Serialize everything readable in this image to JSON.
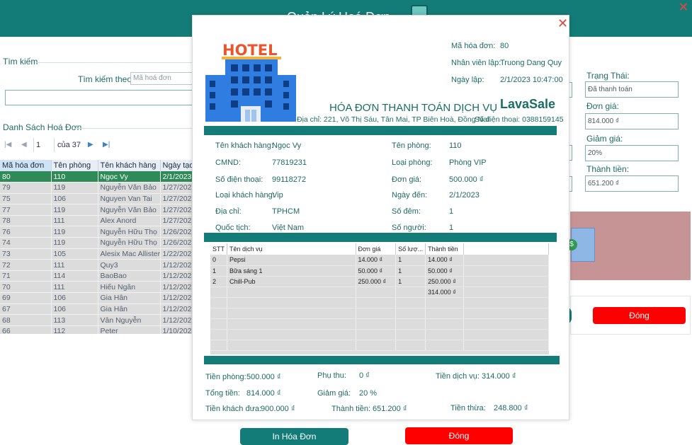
{
  "background_window": {
    "title": "Quản Lý Hoá Đơn",
    "search": {
      "legend": "Tìm kiếm",
      "search_by_label": "Tìm kiếm theo:",
      "search_by_value": "Mã hoá đơn",
      "input_value": ""
    },
    "list": {
      "legend": "Danh Sách Hoá Đơn",
      "pager": {
        "current_page": "1",
        "of_text": "của 37"
      },
      "columns": [
        "Mã hóa đơn",
        "Tên phòng",
        "Tên khách hàng",
        "Ngày tạo"
      ],
      "rows": [
        [
          "80",
          "110",
          "Ngọc Vy",
          "2/1/2023"
        ],
        [
          "79",
          "119",
          "Nguyễn Văn Bảo",
          "1/27/2023"
        ],
        [
          "75",
          "106",
          "Nguyen Van Tai",
          "1/27/2023"
        ],
        [
          "77",
          "119",
          "Nguyễn Văn Bảo",
          "1/27/2023"
        ],
        [
          "78",
          "111",
          "Alex Anord",
          "1/27/2023"
        ],
        [
          "76",
          "119",
          "Nguyễn Hữu Thọ",
          "1/26/2023"
        ],
        [
          "74",
          "119",
          "Nguyễn Hữu Thọ",
          "1/26/2023"
        ],
        [
          "73",
          "105",
          "Alesix Mac Allister",
          "1/22/2023"
        ],
        [
          "72",
          "111",
          "Quy3",
          "1/12/2023"
        ],
        [
          "71",
          "114",
          "BaoBao",
          "1/12/2023"
        ],
        [
          "70",
          "111",
          "Hiếu Ngân",
          "1/12/2023"
        ],
        [
          "69",
          "106",
          "Gia Hân",
          "1/12/2023"
        ],
        [
          "67",
          "106",
          "Gia Hân",
          "1/12/2023"
        ],
        [
          "68",
          "113",
          "Vân Nguyễn",
          "1/12/2023"
        ],
        [
          "66",
          "112",
          "Peter",
          "1/10/2023"
        ]
      ]
    },
    "right_panel": {
      "status_label": "Trạng Thái:",
      "status_value": "Đã thanh toán",
      "price_label": "Đơn giá:",
      "price_value": "814.000 ₫",
      "discount_label": "Giảm giá:",
      "discount_value": "20%",
      "total_label": "Thành tiền:",
      "total_value": "651.200 ₫",
      "close_button": "Đóng"
    }
  },
  "invoice_dialog": {
    "close_icon": "close-icon",
    "logo_text": "HOTEL",
    "header": {
      "invoice_id_label": "Mã hóa đơn:",
      "invoice_id": "80",
      "staff_label": "Nhân viên lập:",
      "staff": "Truong Dang Quy",
      "date_label": "Ngày lập:",
      "date": "2/1/2023 10:47:00"
    },
    "title": "HÓA ĐƠN THANH TOÁN DỊCH VỤ",
    "brand": "LavaSale",
    "address": "Địa chỉ: 221, Võ Thị Sáu, Tân Mai, TP Biên Hoà, Đồng Nai",
    "phone": "Số điện thoại: 0388159145",
    "customer": {
      "name_label": "Tên khách hàng:",
      "name": "Ngọc Vy",
      "id_label": "CMND:",
      "id": "77819231",
      "phone_label": "Số điện thoại:",
      "phone": "99118272",
      "type_label": "Loại khách hàng:",
      "type": "Vip",
      "address_label": "Địa chỉ:",
      "address": "TPHCM",
      "nationality_label": "Quốc tịch:",
      "nationality": "Việt Nam"
    },
    "room": {
      "name_label": "Tên phòng:",
      "name": "110",
      "type_label": "Loại phòng:",
      "type": "Phòng VIP",
      "price_label": "Đơn giá:",
      "price": "500.000 ₫",
      "arrival_label": "Ngày đến:",
      "arrival": "2/1/2023",
      "nights_label": "Số đêm:",
      "nights": "1",
      "people_label": "Số người:",
      "people": "1"
    },
    "services": {
      "columns": [
        "STT",
        "Tên dịch vụ",
        "Đơn giá",
        "Số lượ...",
        "Thành tiền"
      ],
      "rows": [
        [
          "0",
          "Pepsi",
          "14.000 ₫",
          "1",
          "14.000 ₫"
        ],
        [
          "1",
          "Bữa sáng 1",
          "50.000 ₫",
          "1",
          "50.000 ₫"
        ],
        [
          "2",
          "Chill-Pub",
          "250.000 ₫",
          "1",
          "250.000 ₫"
        ],
        [
          "",
          "",
          "",
          "",
          "314.000 ₫"
        ]
      ]
    },
    "summary": {
      "room_fee_label": "Tiền phòng:",
      "room_fee": "500.000 ₫",
      "surcharge_label": "Phụ thu:",
      "surcharge": "0 ₫",
      "service_fee_label": "Tiền dịch vụ:",
      "service_fee": "314.000 ₫",
      "total_label": "Tổng tiền:",
      "total": "814.000 ₫",
      "discount_label": "Giảm giá:",
      "discount": "20 %",
      "paid_label": "Tiền khách đưa:",
      "paid": "900.000 ₫",
      "final_label": "Thành tiền:",
      "final": "651.200 ₫",
      "change_label": "Tiền thừa:",
      "change": "248.800 ₫"
    },
    "print_button": "In Hóa Đơn",
    "close_button": "Đóng"
  }
}
